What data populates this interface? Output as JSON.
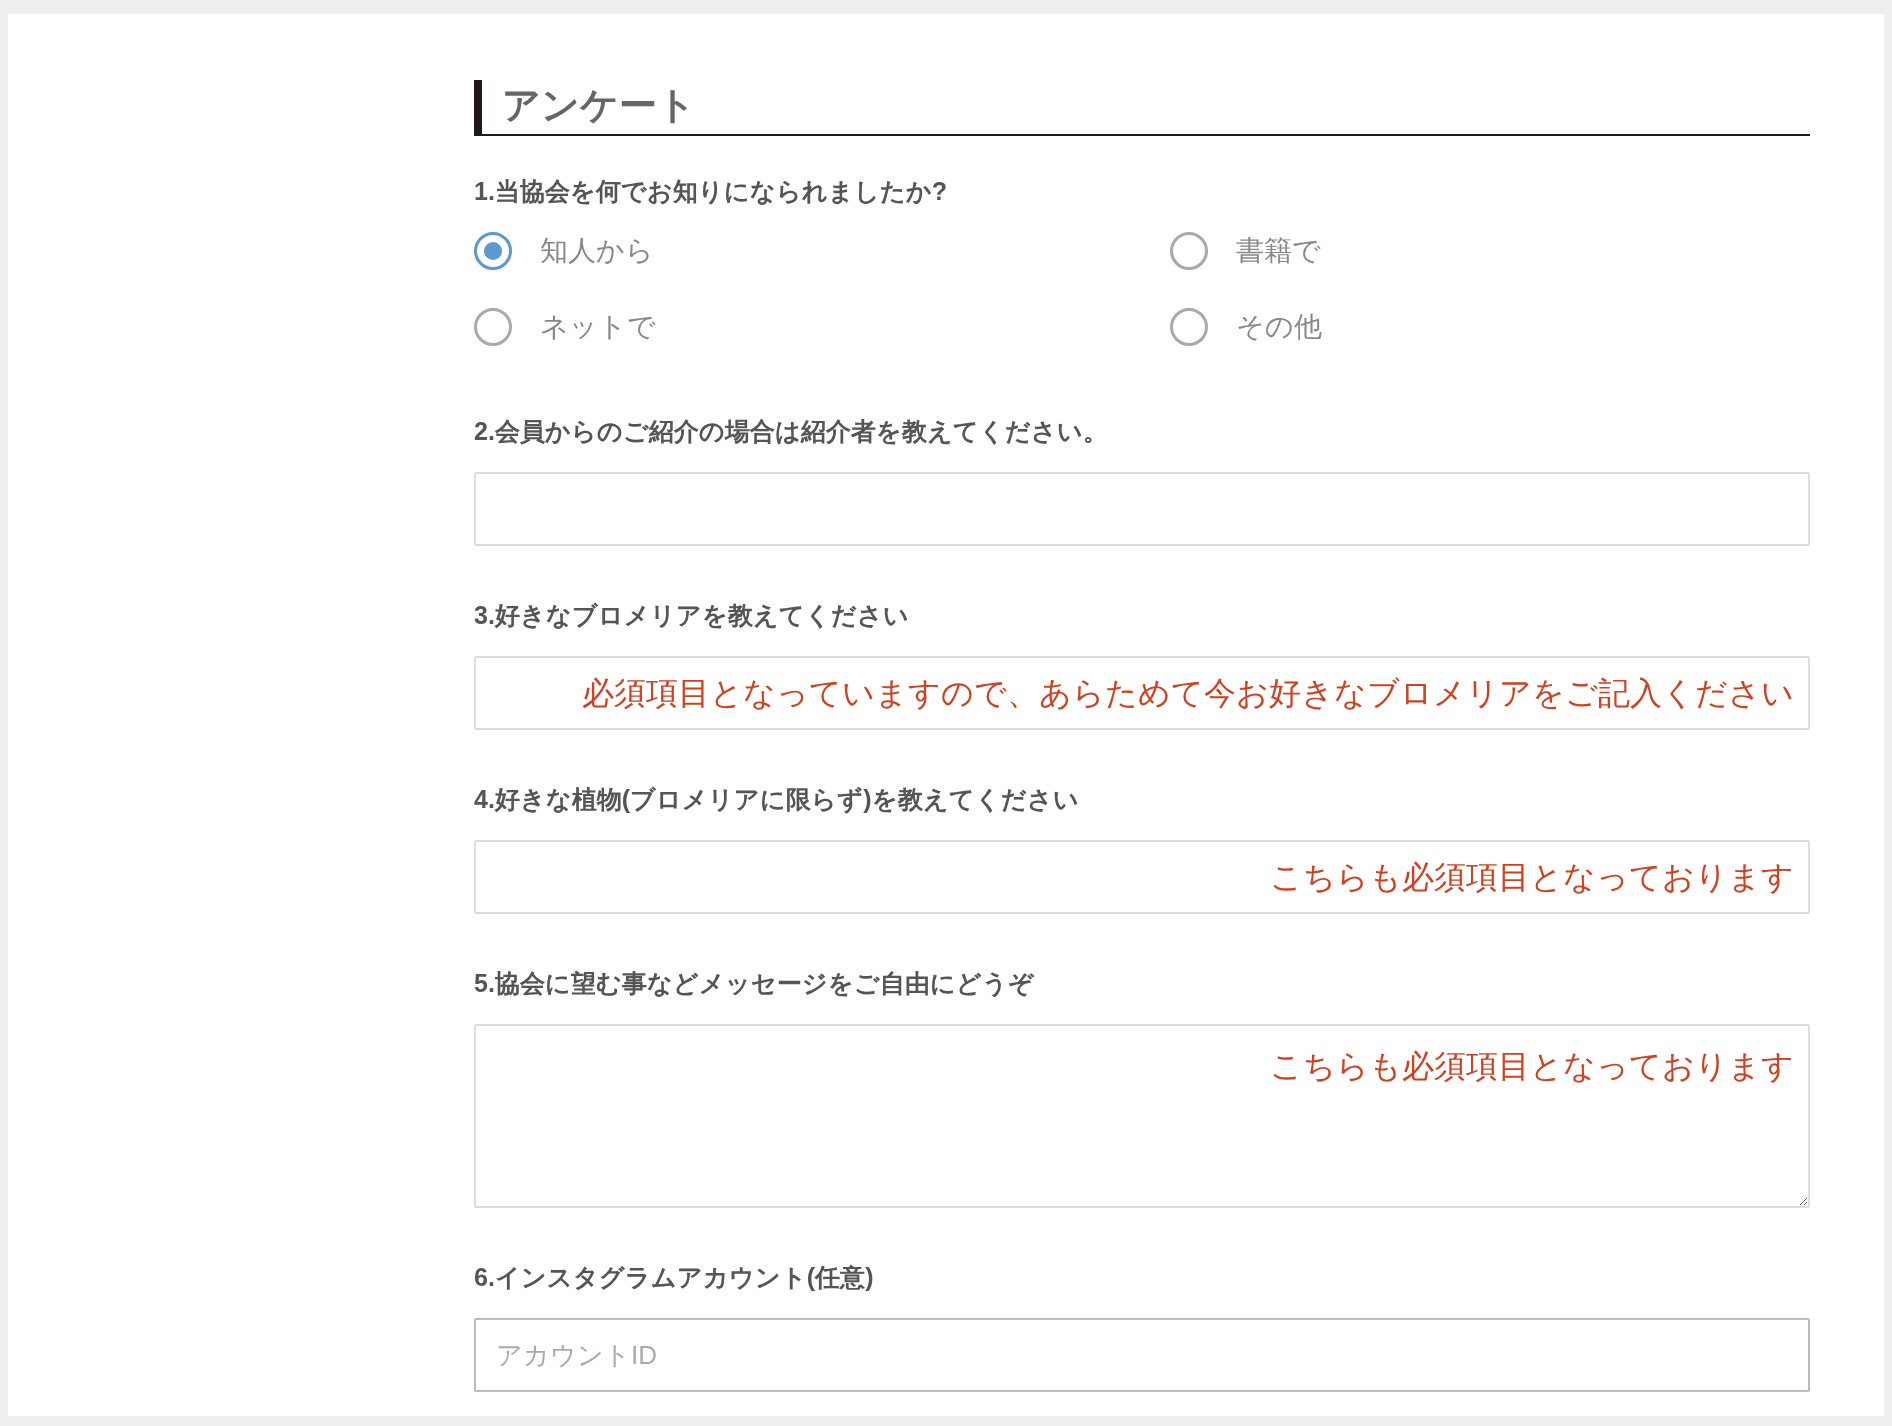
{
  "heading": "アンケート",
  "questions": [
    {
      "kind": "radio",
      "label": "1.当協会を何でお知りになられましたか?",
      "options": [
        {
          "label": "知人から",
          "selected": true
        },
        {
          "label": "書籍で",
          "selected": false
        },
        {
          "label": "ネットで",
          "selected": false
        },
        {
          "label": "その他",
          "selected": false
        }
      ]
    },
    {
      "kind": "text",
      "label": "2.会員からのご紹介の場合は紹介者を教えてください。"
    },
    {
      "kind": "text",
      "label": "3.好きなブロメリアを教えてください",
      "placeholder": "必須項目となっていますので、あらためて今お好きなブロメリアをご記入ください",
      "error": true
    },
    {
      "kind": "text",
      "label": "4.好きな植物(ブロメリアに限らず)を教えてください",
      "placeholder": "こちらも必須項目となっております",
      "error": true
    },
    {
      "kind": "textarea",
      "label": "5.協会に望む事などメッセージをご自由にどうぞ",
      "placeholder": "こちらも必須項目となっております",
      "error": true
    },
    {
      "kind": "text",
      "label": "6.インスタグラムアカウント(任意)",
      "placeholder": "アカウントID",
      "error": false
    }
  ]
}
